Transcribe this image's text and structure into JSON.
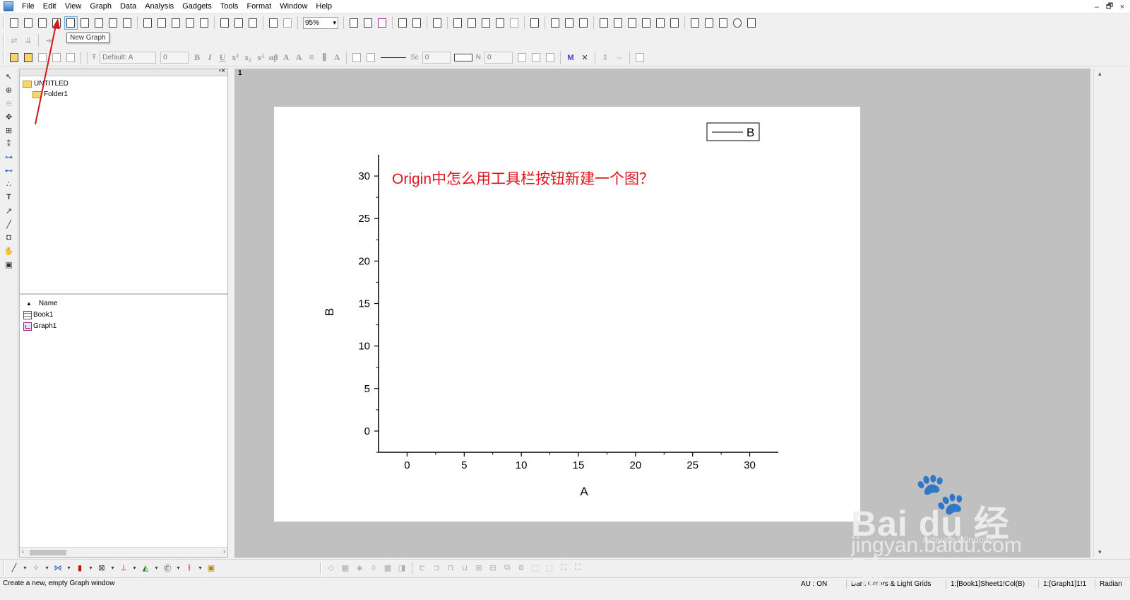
{
  "menu": [
    "File",
    "Edit",
    "View",
    "Graph",
    "Data",
    "Analysis",
    "Gadgets",
    "Tools",
    "Format",
    "Window",
    "Help"
  ],
  "window_controls": [
    "–",
    "🗗",
    "×"
  ],
  "toolbar": {
    "zoom": "95%",
    "font": "Default: A",
    "font_size": "0",
    "line_style": "Sc",
    "line_width": "0",
    "fill_label": "N",
    "fill_num": "0"
  },
  "tooltip": "New Graph",
  "explorer": {
    "root": "UNTITLED",
    "folder": "Folder1",
    "list_header": "Name",
    "items": [
      "Book1",
      "Graph1"
    ]
  },
  "graph": {
    "page_number": "1",
    "legend": "B",
    "annotation": "Origin中怎么用工具栏按钮新建一个图？",
    "annotation_color": "#e0141e"
  },
  "chart_data": {
    "type": "line",
    "title": "",
    "xlabel": "A",
    "ylabel": "B",
    "xlim": [
      -2.5,
      32.5
    ],
    "ylim": [
      -2.5,
      32.5
    ],
    "x_ticks": [
      "0",
      "5",
      "10",
      "15",
      "20",
      "25",
      "30"
    ],
    "y_ticks": [
      "0",
      "5",
      "10",
      "15",
      "20",
      "25",
      "30"
    ],
    "series": [
      {
        "name": "B",
        "values": []
      }
    ],
    "legend_position": "top-right",
    "grid": false
  },
  "status": {
    "message": "Create a new, empty Graph window",
    "au": "AU : ON",
    "theme": "Dark Colors & Light Grids",
    "col": "1:[Book1]Sheet1!Col(B)",
    "graph": "1:[Graph1]1!1",
    "angle": "Radian"
  },
  "watermark": {
    "brand": "Bai du 经验",
    "url": "jingyan.baidu.com",
    "activate": "Activate Windows"
  },
  "arrow_color": "#d01818"
}
